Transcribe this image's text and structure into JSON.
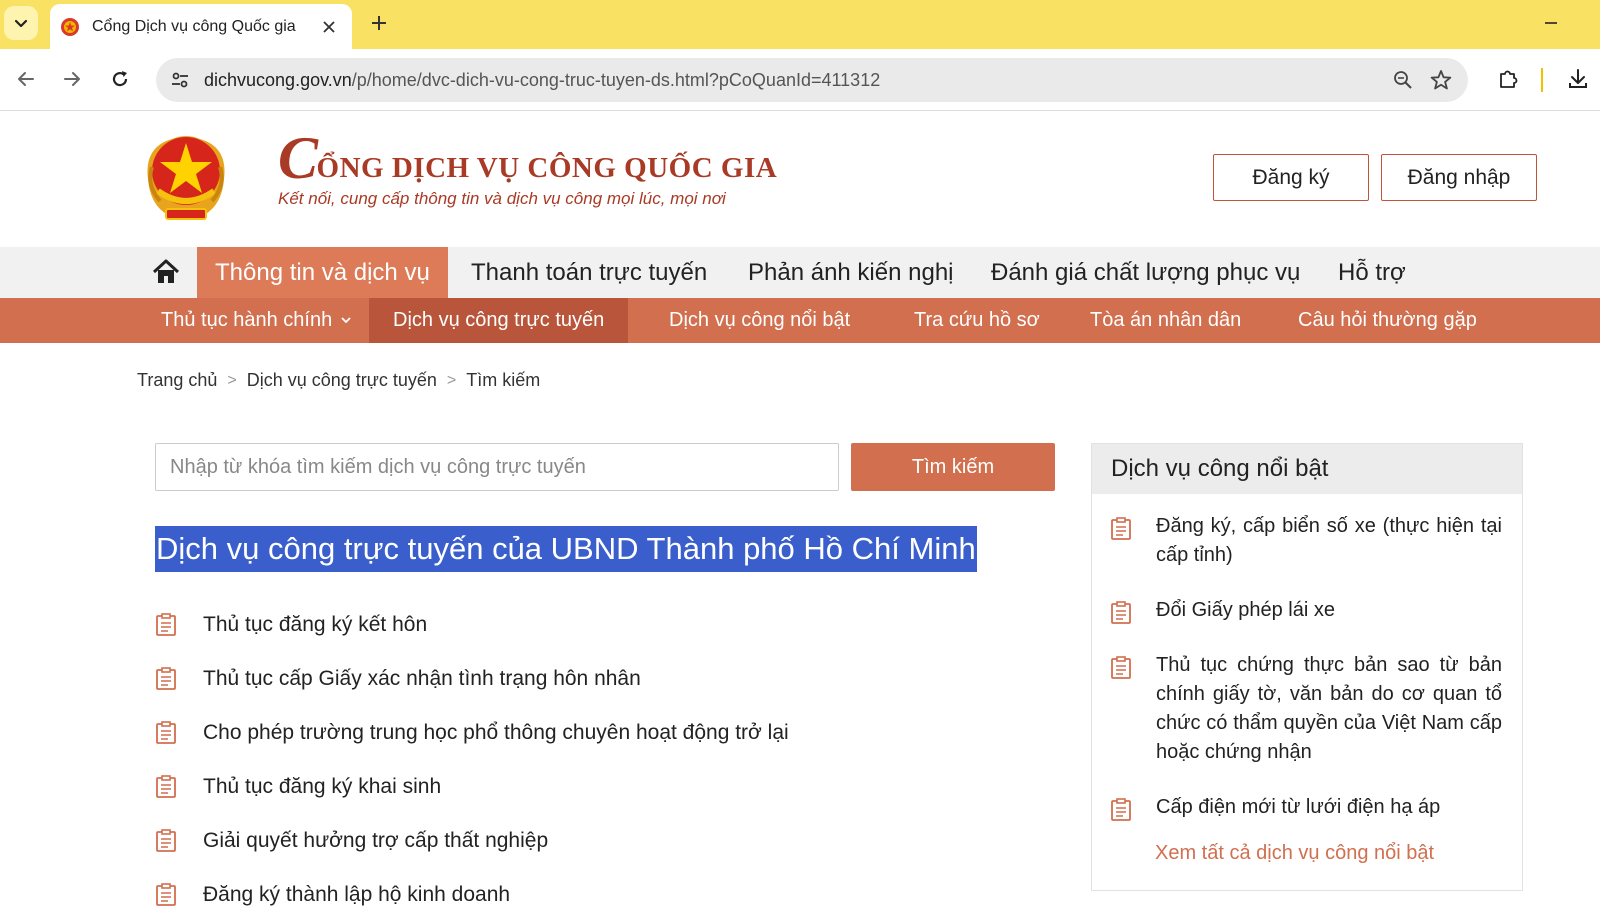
{
  "browser": {
    "tab_title": "Cổng Dịch vụ công Quốc gia",
    "url_host": "dichvucong.gov.vn",
    "url_path": "/p/home/dvc-dich-vu-cong-truc-tuyen-ds.html?pCoQuanId=411312",
    "theme_color": "#f9e163"
  },
  "header": {
    "brand_first_letter": "C",
    "brand_rest": "ỔNG DỊCH VỤ CÔNG QUỐC GIA",
    "tagline": "Kết nối, cung cấp thông tin và dịch vụ công mọi lúc, mọi nơi",
    "register_label": "Đăng ký",
    "login_label": "Đăng nhập",
    "brand_color": "#a83a26"
  },
  "main_nav": {
    "items": [
      {
        "label": "Thông tin và dịch vụ",
        "active": true
      },
      {
        "label": "Thanh toán trực tuyến"
      },
      {
        "label": "Phản ánh kiến nghị"
      },
      {
        "label": "Đánh giá chất lượng phục vụ"
      },
      {
        "label": "Hỗ trợ"
      }
    ]
  },
  "sub_nav": {
    "items": [
      {
        "label": "Thủ tục hành chính"
      },
      {
        "label": "Dịch vụ công trực tuyến",
        "active": true
      },
      {
        "label": "Dịch vụ công nổi bật"
      },
      {
        "label": "Tra cứu hồ sơ"
      },
      {
        "label": "Tòa án nhân dân"
      },
      {
        "label": "Câu hỏi thường gặp"
      }
    ],
    "accent_color": "#d16f4f"
  },
  "breadcrumb": {
    "items": [
      "Trang chủ",
      "Dịch vụ công trực tuyến",
      "Tìm kiếm"
    ],
    "separator": ">"
  },
  "search": {
    "placeholder": "Nhập từ khóa tìm kiếm dịch vụ công trực tuyến",
    "value": "",
    "button_label": "Tìm kiếm"
  },
  "page_heading": "Dịch vụ công trực tuyến của UBND Thành phố Hồ Chí Minh",
  "services": [
    "Thủ tục đăng ký kết hôn",
    "Thủ tục cấp Giấy xác nhận tình trạng hôn nhân",
    "Cho phép trường trung học phổ thông chuyên hoạt động trở lại",
    "Thủ tục đăng ký khai sinh",
    "Giải quyết hưởng trợ cấp thất nghiệp",
    "Đăng ký thành lập hộ kinh doanh"
  ],
  "sidebar": {
    "title": "Dịch vụ công nổi bật",
    "items": [
      "Đăng ký, cấp biển số xe (thực hiện tại cấp tỉnh)",
      "Đổi Giấy phép lái xe",
      "Thủ tục chứng thực bản sao từ bản chính giấy tờ, văn bản do cơ quan tổ chức có thẩm quyền của Việt Nam cấp hoặc chứng nhận",
      "Cấp điện mới từ lưới điện hạ áp"
    ],
    "more_link": "Xem tất cả dịch vụ công nổi bật"
  }
}
